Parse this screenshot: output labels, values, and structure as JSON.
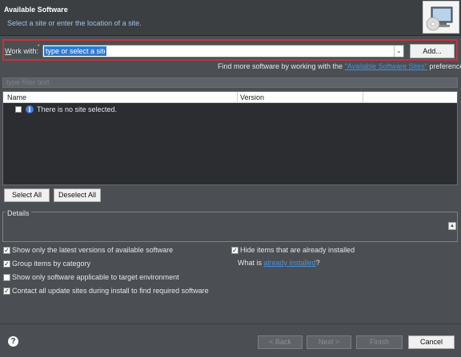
{
  "header": {
    "title": "Available Software",
    "description": "Select a site or enter the location of a site."
  },
  "work_with": {
    "label_prefix": "W",
    "label_rest": "ork with:",
    "required_marker": "*",
    "placeholder": "type or select a site",
    "add_button": "Add..."
  },
  "find_more": {
    "prefix": "Find more software by working with the",
    "link": "\"Available Software Sites\"",
    "suffix": "preferences."
  },
  "filter": {
    "placeholder": "type filter text"
  },
  "table": {
    "columns": [
      "Name",
      "Version"
    ],
    "message": "There is no site selected."
  },
  "selection_buttons": {
    "select_all": "Select All",
    "deselect_all": "Deselect All"
  },
  "details": {
    "label": "Details"
  },
  "options": [
    {
      "label": "Show only the latest versions of available software",
      "checked": true
    },
    {
      "label": "Group items by category",
      "checked": true
    },
    {
      "label": "Show only software applicable to target environment",
      "checked": false
    },
    {
      "label": "Contact all update sites during install to find required software",
      "checked": true
    },
    {
      "label": "Hide items that are already installed",
      "checked": true
    }
  ],
  "what_is": {
    "prefix": "What is",
    "link": "already installed",
    "suffix": "?"
  },
  "footer": {
    "back": "< Back",
    "next": "Next >",
    "finish": "Finish",
    "cancel": "Cancel"
  },
  "colors": {
    "accent_link": "#4a90d9",
    "highlight_border": "#c8323c",
    "selection": "#2f7bd3"
  }
}
